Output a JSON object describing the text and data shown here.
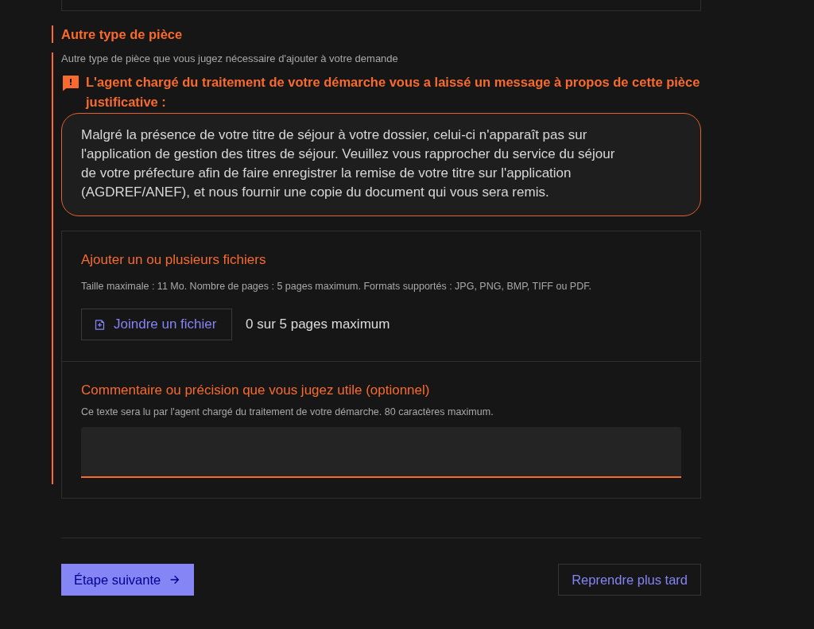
{
  "piece": {
    "title": "Autre type de pièce",
    "hint": "Autre type de pièce que vous jugez nécessaire d'ajouter à votre demande"
  },
  "agent_message": {
    "title": "L'agent chargé du traitement de votre démarche vous a laissé un message à propos de cette pièce justificative :",
    "body": "Malgré la présence de votre titre de séjour à votre dossier, celui-ci n'apparaît pas sur l'application de gestion des titres de séjour. Veuillez vous rapprocher du service du séjour de votre préfecture afin de faire enregistrer la remise de votre titre sur l'application (AGDREF/ANEF), et nous fournir une copie du document qui vous sera remis."
  },
  "upload": {
    "title": "Ajouter un ou plusieurs fichiers",
    "hint": "Taille maximale : 11 Mo. Nombre de pages : 5 pages maximum. Formats supportés : JPG, PNG, BMP, TIFF ou PDF.",
    "button": "Joindre un fichier",
    "count": "0 sur 5 pages maximum"
  },
  "comment": {
    "label": "Commentaire ou précision que vous jugez utile (optionnel)",
    "hint": "Ce texte sera lu par l'agent chargé du traitement de votre démarche. 80 caractères maximum."
  },
  "actions": [
    {
      "label": "Étape suivante",
      "kind": "primary"
    },
    {
      "label": "Reprendre plus tard",
      "kind": "secondary"
    }
  ]
}
